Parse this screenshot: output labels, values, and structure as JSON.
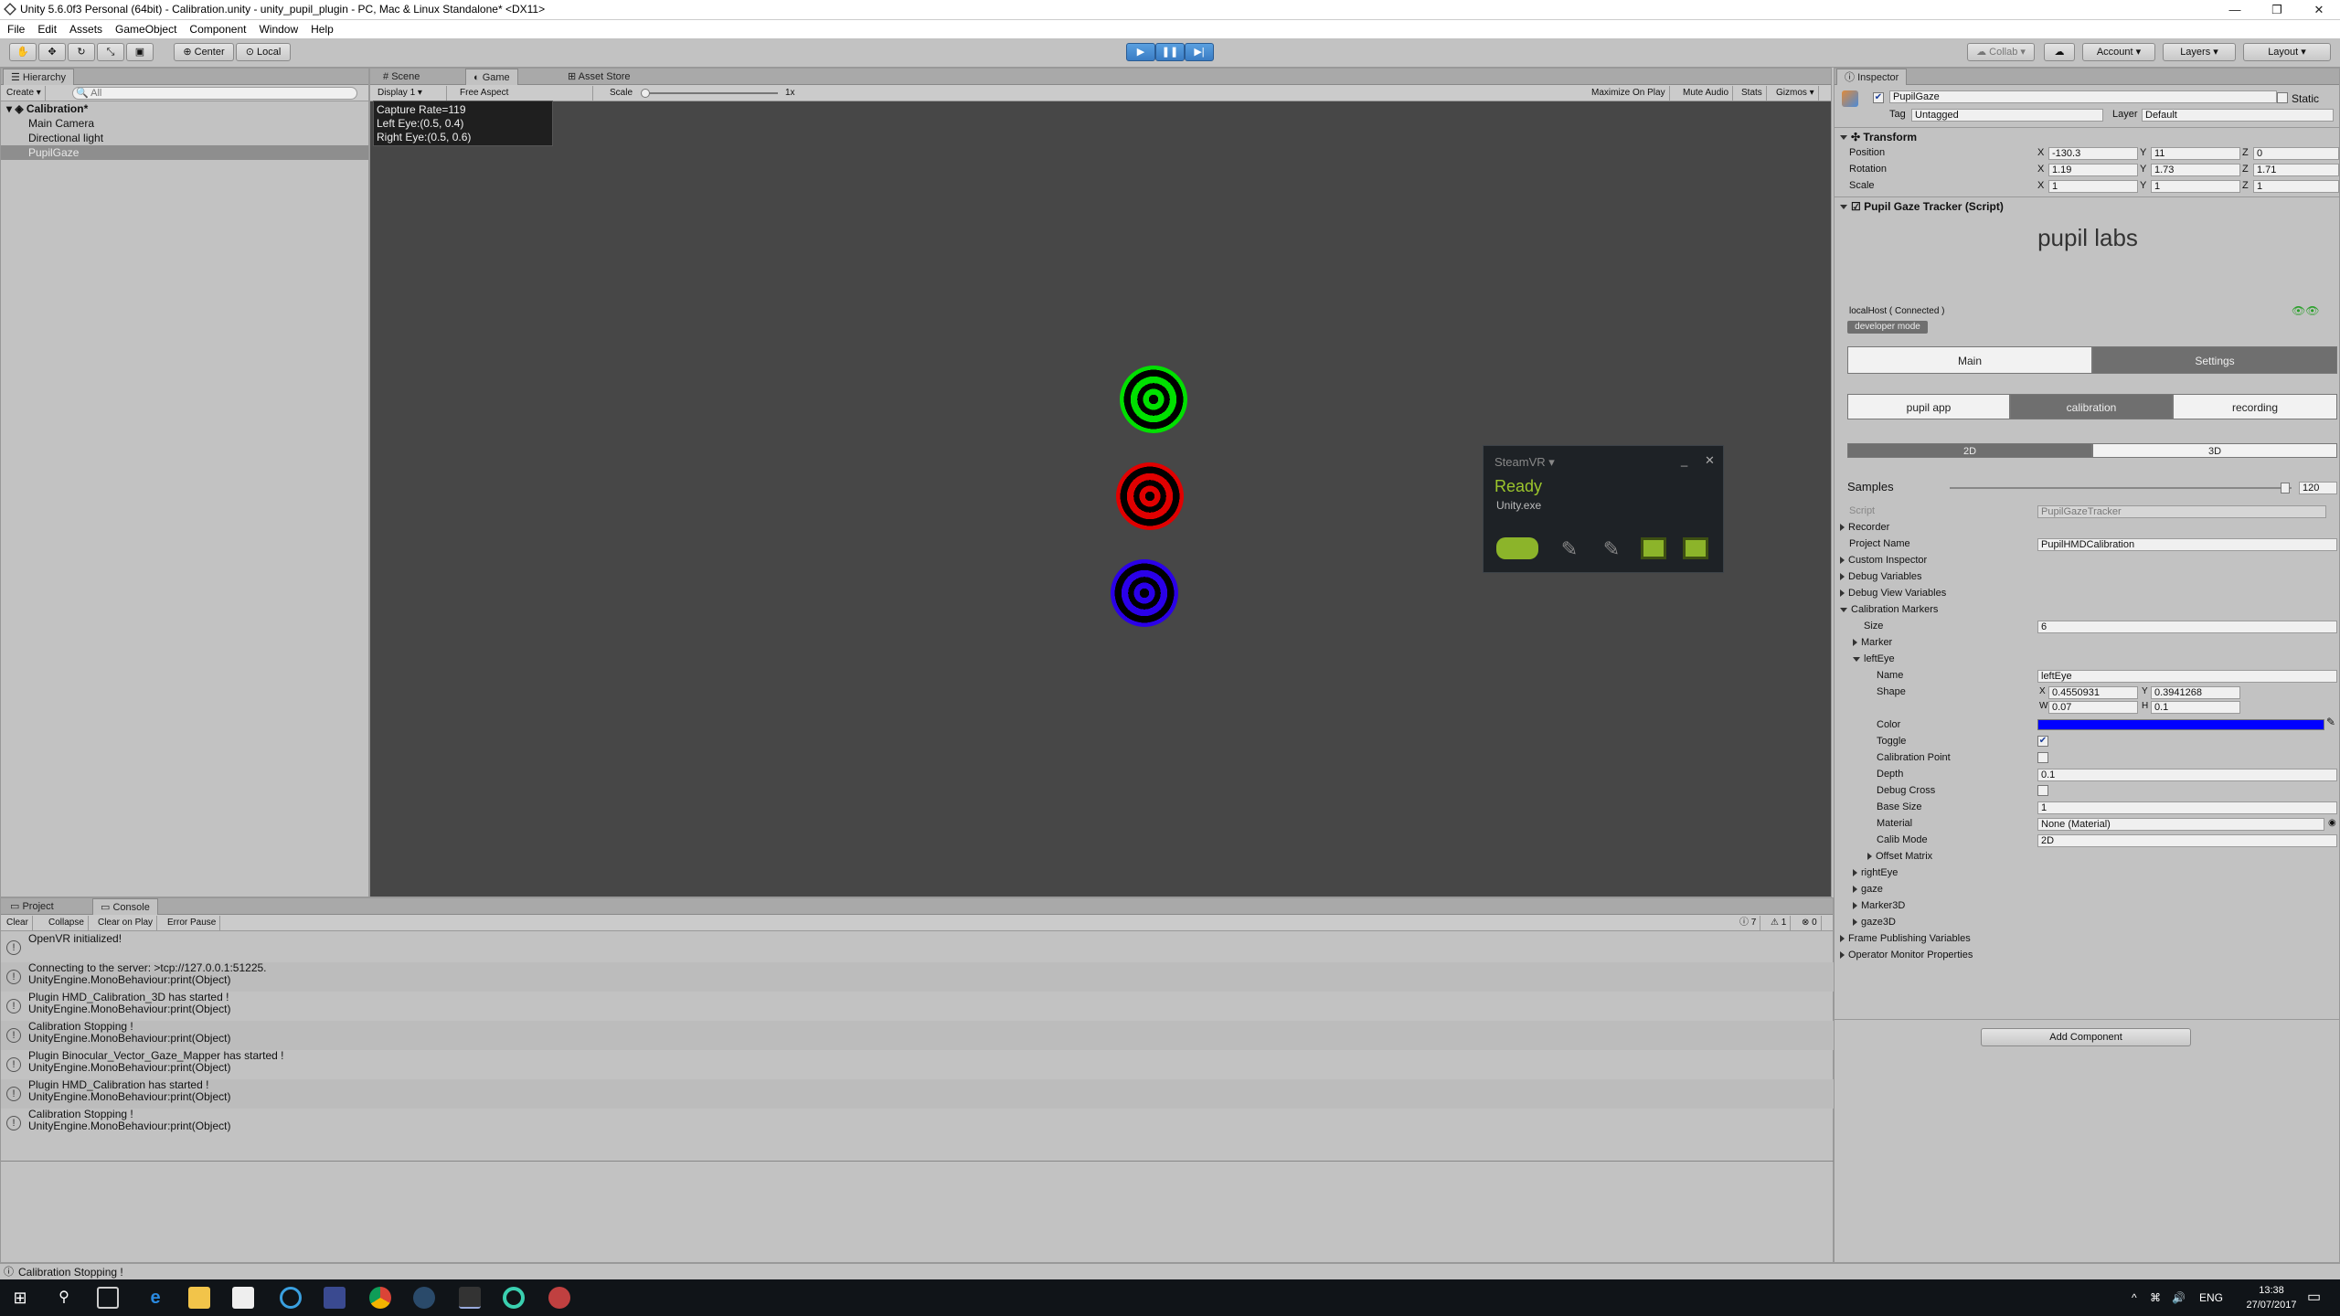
{
  "window": {
    "title": "Unity 5.6.0f3 Personal (64bit) - Calibration.unity - unity_pupil_plugin - PC, Mac & Linux Standalone* <DX11>"
  },
  "menu": [
    "File",
    "Edit",
    "Assets",
    "GameObject",
    "Component",
    "Window",
    "Help"
  ],
  "toolbar": {
    "center": "Center",
    "local": "Local",
    "collab": "Collab",
    "account": "Account",
    "layers": "Layers",
    "layout": "Layout"
  },
  "hierarchy": {
    "tab": "Hierarchy",
    "create": "Create",
    "search_placeholder": "All",
    "scene": "Calibration*",
    "items": [
      "Main Camera",
      "Directional light",
      "PupilGaze"
    ]
  },
  "scene_tabs": {
    "scene": "Scene",
    "game": "Game",
    "asset_store": "Asset Store"
  },
  "game_bar": {
    "display": "Display 1",
    "aspect": "Free Aspect",
    "scale_label": "Scale",
    "scale_value": "1x",
    "maximize": "Maximize On Play",
    "mute": "Mute Audio",
    "stats": "Stats",
    "gizmos": "Gizmos"
  },
  "capture": {
    "line1": "Capture Rate=119",
    "line2": "Left Eye:(0.5, 0.4)",
    "line3": "Right Eye:(0.5, 0.6)"
  },
  "targets": {
    "colors": [
      "#00e000",
      "#e00000",
      "#2a00e8"
    ]
  },
  "steamvr": {
    "title": "SteamVR ▾",
    "status": "Ready",
    "app": "Unity.exe",
    "minimize": "_",
    "close": "✕"
  },
  "console": {
    "tabs": [
      "Project",
      "Console"
    ],
    "buttons": [
      "Clear",
      "Collapse",
      "Clear on Play",
      "Error Pause"
    ],
    "counts": {
      "log": "7",
      "warn": "1",
      "error": "0"
    },
    "entries": [
      {
        "l1": "OpenVR initialized!",
        "l2": ""
      },
      {
        "l1": "Connecting to the server: >tcp://127.0.0.1:51225.",
        "l2": "UnityEngine.MonoBehaviour:print(Object)"
      },
      {
        "l1": "Plugin HMD_Calibration_3D has started !",
        "l2": "UnityEngine.MonoBehaviour:print(Object)"
      },
      {
        "l1": "Calibration Stopping !",
        "l2": "UnityEngine.MonoBehaviour:print(Object)"
      },
      {
        "l1": "Plugin Binocular_Vector_Gaze_Mapper has started !",
        "l2": "UnityEngine.MonoBehaviour:print(Object)"
      },
      {
        "l1": "Plugin HMD_Calibration has started !",
        "l2": "UnityEngine.MonoBehaviour:print(Object)"
      },
      {
        "l1": "Calibration Stopping !",
        "l2": "UnityEngine.MonoBehaviour:print(Object)"
      }
    ]
  },
  "inspector": {
    "tab": "Inspector",
    "object_name": "PupilGaze",
    "static": "Static",
    "tag_label": "Tag",
    "tag": "Untagged",
    "layer_label": "Layer",
    "layer": "Default",
    "transform": {
      "title": "Transform",
      "position_label": "Position",
      "position": {
        "x": "-130.3",
        "y": "11",
        "z": "0"
      },
      "rotation_label": "Rotation",
      "rotation": {
        "x": "1.19",
        "y": "1.73",
        "z": "1.71"
      },
      "scale_label": "Scale",
      "scale": {
        "x": "1",
        "y": "1",
        "z": "1"
      },
      "x": "X",
      "y": "Y",
      "z": "Z"
    },
    "script_title": "Pupil Gaze Tracker (Script)",
    "logo": "pupil labs",
    "connection": "localHost ( Connected )",
    "dev_mode": "developer mode",
    "main_tab": "Main",
    "settings_tab": "Settings",
    "modes": [
      "pupil app",
      "calibration",
      "recording"
    ],
    "dims": [
      "2D",
      "3D"
    ],
    "samples_label": "Samples",
    "samples_value": "120",
    "script_label": "Script",
    "script_value": "PupilGazeTracker",
    "recorder": "Recorder",
    "project_name_label": "Project Name",
    "project_name": "PupilHMDCalibration",
    "custom_inspector": "Custom Inspector",
    "debug_vars": "Debug Variables",
    "debug_view_vars": "Debug View Variables",
    "cal_markers": "Calibration Markers",
    "size_label": "Size",
    "size": "6",
    "marker": "Marker",
    "left_eye": "leftEye",
    "name_label": "Name",
    "name_value": "leftEye",
    "shape_label": "Shape",
    "shape": {
      "x": "0.4550931",
      "y": "0.3941268",
      "w": "0.07",
      "h": "0.1"
    },
    "w": "W",
    "h": "H",
    "color_label": "Color",
    "color_value": "#0000ff",
    "toggle_label": "Toggle",
    "cal_point_label": "Calibration Point",
    "depth_label": "Depth",
    "depth": "0.1",
    "debug_cross_label": "Debug Cross",
    "base_size_label": "Base Size",
    "base_size": "1",
    "material_label": "Material",
    "material": "None (Material)",
    "calib_mode_label": "Calib Mode",
    "calib_mode": "2D",
    "offset_matrix": "Offset Matrix",
    "right_eye": "rightEye",
    "gaze": "gaze",
    "marker3d": "Marker3D",
    "gaze3d": "gaze3D",
    "frame_pub": "Frame Publishing Variables",
    "op_monitor": "Operator Monitor Properties",
    "add_component": "Add Component"
  },
  "status": "Calibration Stopping !",
  "tray": {
    "lang": "ENG",
    "time": "13:38",
    "date": "27/07/2017"
  }
}
